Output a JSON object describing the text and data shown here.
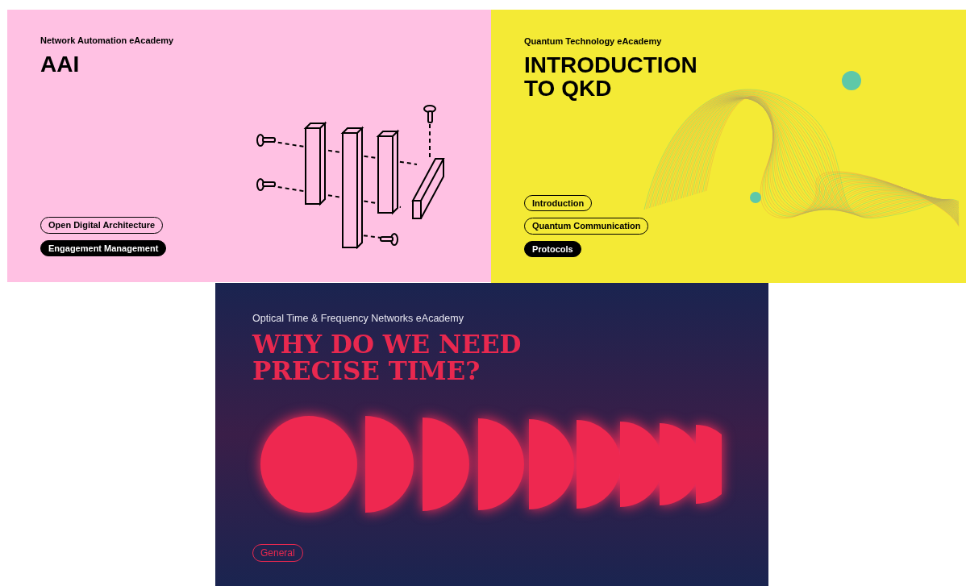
{
  "cards": [
    {
      "kind": "automation",
      "academy": "Network Automation eAcademy",
      "title": "AAI",
      "tags": [
        {
          "label": "Open Digital Architecture",
          "selected": false
        },
        {
          "label": "Engagement Management",
          "selected": true
        }
      ]
    },
    {
      "kind": "quantum",
      "academy": "Quantum Technology eAcademy",
      "title": "INTRODUCTION TO QKD",
      "tags": [
        {
          "label": "Introduction",
          "selected": false
        },
        {
          "label": "Quantum Communication",
          "selected": false
        },
        {
          "label": "Protocols",
          "selected": true
        }
      ]
    },
    {
      "kind": "timing",
      "academy": "Optical Time & Frequency Networks eAcademy",
      "title": "WHY DO WE NEED PRECISE TIME?",
      "tags": [
        {
          "label": "General",
          "selected": false
        }
      ]
    }
  ]
}
